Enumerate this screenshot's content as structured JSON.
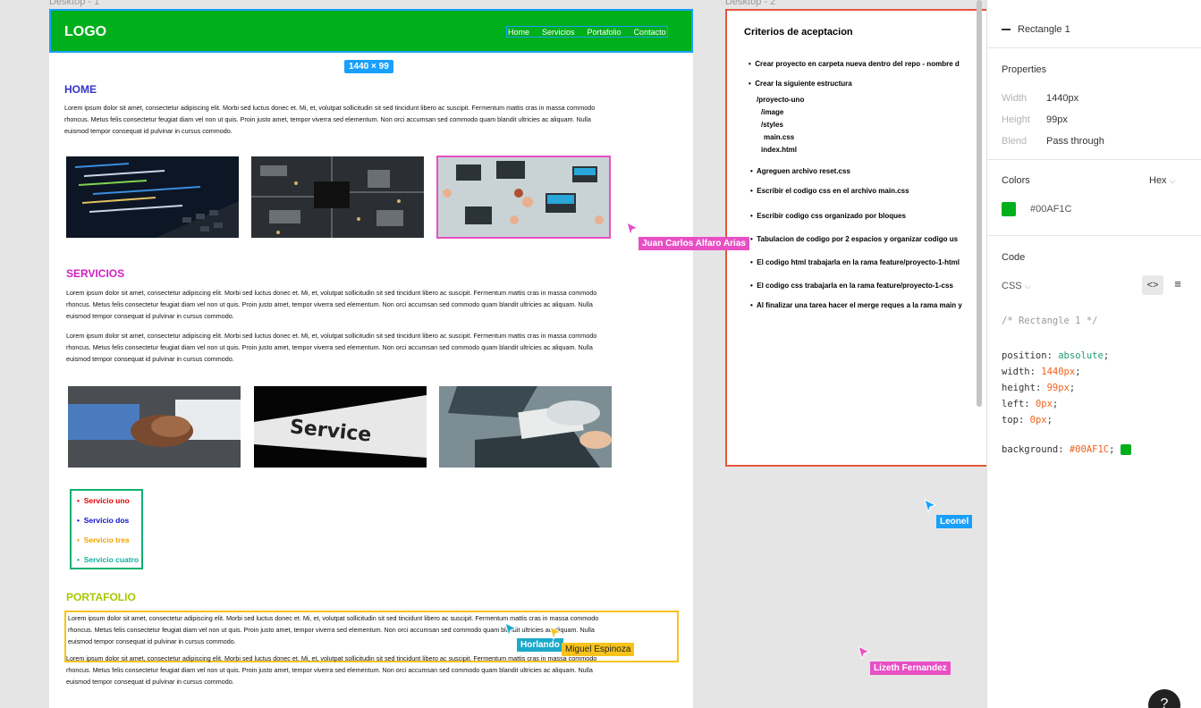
{
  "canvas": {
    "frame1_label": "Desktop - 1",
    "frame2_label": "Desktop - 2",
    "dimension_badge": "1440 × 99"
  },
  "site": {
    "logo": "LOGO",
    "nav": [
      "Home",
      "Servicios",
      "Portafolio",
      "Contacto"
    ],
    "home_title": "HOME",
    "lorem_line1": "Lorem ipsum dolor sit amet, consectetur adipiscing elit. Morbi sed luctus donec et. Mi, et, volutpat sollicitudin sit sed tincidunt libero ac suscipit. Fermentum mattis cras in massa commodo",
    "lorem_line2": "rhoncus. Metus felis consectetur feugiat diam vel non ut quis. Proin justo amet, tempor viverra sed elementum. Non orci accumsan sed commodo quam blandit ultricies ac aliquam. Nulla",
    "lorem_line3": "euismod tempor consequat id pulvinar in cursus commodo.",
    "servicios_title": "SERVICIOS",
    "service_image_word": "Service",
    "services": [
      {
        "label": "Servicio uno",
        "color": "#e00000"
      },
      {
        "label": "Servicio dos",
        "color": "#1010d0"
      },
      {
        "label": "Servicio tres",
        "color": "#f0a000"
      },
      {
        "label": "Servicio cuatro",
        "color": "#10b0a0"
      }
    ],
    "portafolio_title": "PORTAFOLIO"
  },
  "criterios": {
    "title": "Criterios de aceptacion",
    "items": [
      "Crear proyecto en carpeta nueva dentro del repo - nombre d",
      "Crear la siguiente estructura",
      "Agreguen archivo reset.css",
      "Escribir el codigo css en el archivo main.css",
      "Escribir codigo css organizado por bloques",
      "Tabulacion de codigo por 2 espacios y organizar codigo us",
      "El codigo html trabajarla en la rama feature/proyecto-1-html",
      "El codigo css trabajarla en la rama feature/proyecto-1-css",
      "Al finalizar una tarea hacer el merge reques a la rama main y"
    ],
    "structure": [
      "/proyecto-uno",
      "/image",
      "/styles",
      "main.css",
      "index.html"
    ]
  },
  "cursors": [
    {
      "name": "Juan Carlos Alfaro Arias",
      "color": "#e84fc4"
    },
    {
      "name": "Horlando",
      "color": "#1ba9c9"
    },
    {
      "name": "Miguel Espinoza",
      "color": "#f7c31b"
    },
    {
      "name": "Leonel",
      "color": "#18a0fb"
    },
    {
      "name": "Lizeth Fernandez",
      "color": "#e84fc4"
    }
  ],
  "panel": {
    "layer_name": "Rectangle 1",
    "properties_title": "Properties",
    "width_label": "Width",
    "width_value": "1440px",
    "height_label": "Height",
    "height_value": "99px",
    "blend_label": "Blend",
    "blend_value": "Pass through",
    "colors_title": "Colors",
    "color_format": "Hex",
    "color_value": "#00AF1C",
    "code_title": "Code",
    "code_lang": "CSS",
    "code_comment": "/* Rectangle 1 */",
    "code_lines": [
      {
        "prop": "position",
        "val": "absolute",
        "kind": "kw"
      },
      {
        "prop": "width",
        "val": "1440px",
        "kind": "num"
      },
      {
        "prop": "height",
        "val": "99px",
        "kind": "num"
      },
      {
        "prop": "left",
        "val": "0px",
        "kind": "num"
      },
      {
        "prop": "top",
        "val": "0px",
        "kind": "num"
      }
    ],
    "code_bg_prop": "background",
    "code_bg_val": "#00AF1C",
    "help": "?"
  },
  "colors": {
    "brand_green": "#00AF1C",
    "selection_blue": "#18a0fb",
    "home_title": "#3333cc",
    "servicios_title": "#d020c0",
    "portafolio_title": "#a8c800"
  }
}
